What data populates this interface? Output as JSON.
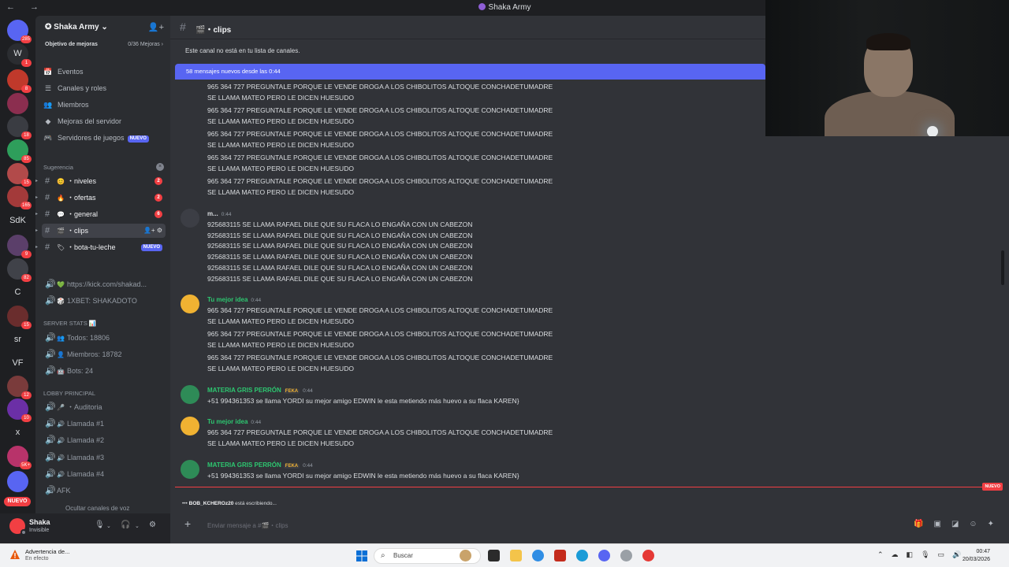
{
  "window": {
    "title": "Shaka Army",
    "nav": "← →"
  },
  "rail": {
    "servers": [
      {
        "label": "",
        "badge": "285",
        "color": "#5865f2"
      },
      {
        "label": "W",
        "badge": "1",
        "color": "#2b2d31"
      },
      {
        "label": "",
        "badge": "8",
        "color": "#c0392b"
      },
      {
        "label": "",
        "badge": "",
        "color": "#8b2e4f"
      },
      {
        "label": "",
        "badge": "18",
        "color": "#3a3c42"
      },
      {
        "label": "",
        "badge": "85",
        "color": "#2e9e5b"
      },
      {
        "label": "",
        "badge": "15",
        "color": "#b24a4a"
      },
      {
        "label": "",
        "badge": "165",
        "color": "#a33a3a"
      },
      {
        "label": "SdK",
        "badge": "",
        "color": ""
      },
      {
        "label": "",
        "badge": "9",
        "color": "#5b3f6a"
      },
      {
        "label": "",
        "badge": "82",
        "color": "#404249"
      },
      {
        "label": "C",
        "badge": "",
        "color": ""
      },
      {
        "label": "",
        "badge": "15",
        "color": "#6a2d2d"
      },
      {
        "label": "sr",
        "badge": "",
        "color": ""
      },
      {
        "label": "VF",
        "badge": "",
        "color": ""
      },
      {
        "label": "",
        "badge": "12",
        "color": "#7a3b3b"
      },
      {
        "label": "",
        "badge": "10",
        "color": "#6b2fa6"
      },
      {
        "label": "x",
        "badge": "",
        "color": ""
      },
      {
        "label": "",
        "badge": "5K+",
        "color": "#b8336a"
      },
      {
        "label": "",
        "badge": "",
        "color": "#5865f2"
      }
    ],
    "new_label": "NUEVO"
  },
  "sidebar": {
    "guild_name": "Shaka Army",
    "boost_goal": "Objetivo de mejoras",
    "boost_count": "0/36 Mejoras",
    "menu": [
      {
        "label": "Eventos",
        "icon": "📅"
      },
      {
        "label": "Canales y roles",
        "icon": "☰"
      },
      {
        "label": "Miembros",
        "icon": "👥"
      },
      {
        "label": "Mejoras del servidor",
        "icon": "◆"
      },
      {
        "label": "Servidores de juegos",
        "icon": "🎮",
        "pill": "NUEVO"
      }
    ],
    "category_suggestion": "Sugerencia",
    "channels": [
      {
        "emoji": "😊",
        "name": "・niveles",
        "count": "2"
      },
      {
        "emoji": "🔥",
        "name": "・ofertas",
        "count": "2"
      },
      {
        "emoji": "💬",
        "name": "・general",
        "count": "6"
      },
      {
        "emoji": "🎬",
        "name": "・clips",
        "count": ""
      },
      {
        "emoji": "🏷",
        "name": "・bota-tu-leche",
        "count": "",
        "pill": "NUEVO"
      }
    ],
    "links": [
      {
        "emoji": "💚",
        "name": "https://kick.com/shakad..."
      },
      {
        "emoji": "🎲",
        "name": "1XBET: SHAKADOTO"
      }
    ],
    "stats_category": "SERVER STATS 📊",
    "stats": [
      {
        "emoji": "👥",
        "name": "Todos: 18806"
      },
      {
        "emoji": "👤",
        "name": "Miembros: 18782"
      },
      {
        "emoji": "🤖",
        "name": "Bots: 24"
      }
    ],
    "lobby_category": "LOBBY PRINCIPAL",
    "voice": [
      {
        "emoji": "🎤",
        "name": "・Auditoria"
      },
      {
        "emoji": "🔊",
        "name": "Llamada #1"
      },
      {
        "emoji": "🔊",
        "name": "Llamada #2"
      },
      {
        "emoji": "🔊",
        "name": "Llamada #3"
      },
      {
        "emoji": "🔊",
        "name": "Llamada #4"
      },
      {
        "emoji": "",
        "name": "AFK"
      }
    ],
    "hidden_voice": "Ocultar canales de voz"
  },
  "user": {
    "name": "Shaka",
    "status": "Invisible"
  },
  "channel": {
    "name": "・clips",
    "notice": "Este canal no está en tu lista de canales.",
    "new_messages": "58 mensajes nuevos desde las 0:44",
    "placeholder": "Enviar mensaje a #🎬・clips",
    "new_label": "NUEVO",
    "typing_user": "BOB_KCHEROz20",
    "typing_text": "está escribiendo..."
  },
  "messages": {
    "l1a": "965 364 727  PREGUNTALE PORQUE LE VENDE DROGA A LOS CHIBOLITOS ALTOQUE CONCHADETUMADRE",
    "l1b": "SE LLAMA MATEO PERO LE DICEN HUESUDO",
    "m_author": "m...",
    "time": "0:44",
    "r_line": "925683115 SE LLAMA RAFAEL DILE QUE SU FLACA LO ENGAÑA CON UN CABEZON",
    "tmi_author": "Tu mejor idea",
    "mg_author": "MATERIA GRIS PERRÓN",
    "mg_tag": "FEKA",
    "mg_line": "+51 994361353 se llama YORDI su mejor amigo EDWIN le esta metiendo más huevo a su flaca KAREN}"
  },
  "taskbar": {
    "warn_title": "Advertencia de...",
    "warn_sub": "En efecto",
    "search": "Buscar",
    "time": "00:47",
    "date": "20/03/2026"
  },
  "colors": {
    "accent": "#5865f2",
    "mention_red": "#f23f43",
    "green_user": "#2dc770"
  }
}
